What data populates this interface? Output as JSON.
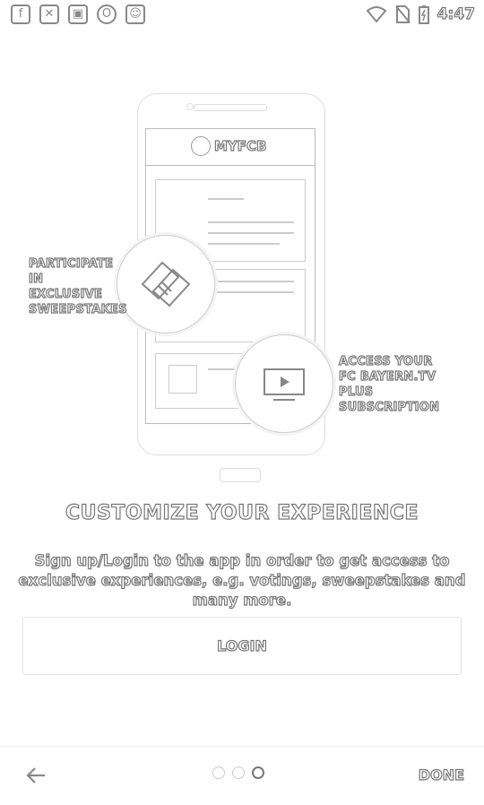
{
  "status_bar": {
    "left_icons": [
      "facebook-icon",
      "tools-icon",
      "lock-icon",
      "opera-icon",
      "android-icon"
    ],
    "right_icons": [
      "wifi-icon",
      "no-sim-icon",
      "battery-charging-icon"
    ],
    "time": "4:47"
  },
  "illustration": {
    "brand": "MYFCB",
    "left_bubble_label": "PARTICIPATE\nIN EXCLUSIVE\nSWEEPSTAKES",
    "right_bubble_label": "ACCESS YOUR\nFC BAYERN.TV PLUS\nSUBSCRIPTION",
    "left_bubble_icon": "tickets-icon",
    "right_bubble_icon": "tv-play-icon"
  },
  "content": {
    "headline": "CUSTOMIZE YOUR EXPERIENCE",
    "body": "Sign up/Login to the app in order to get access to exclusive experiences, e.g. votings, sweepstakes and many more.",
    "login_label": "LOGIN"
  },
  "nav": {
    "back_icon": "arrow-left-icon",
    "page_count": 3,
    "active_page": 3,
    "done_label": "DONE"
  }
}
